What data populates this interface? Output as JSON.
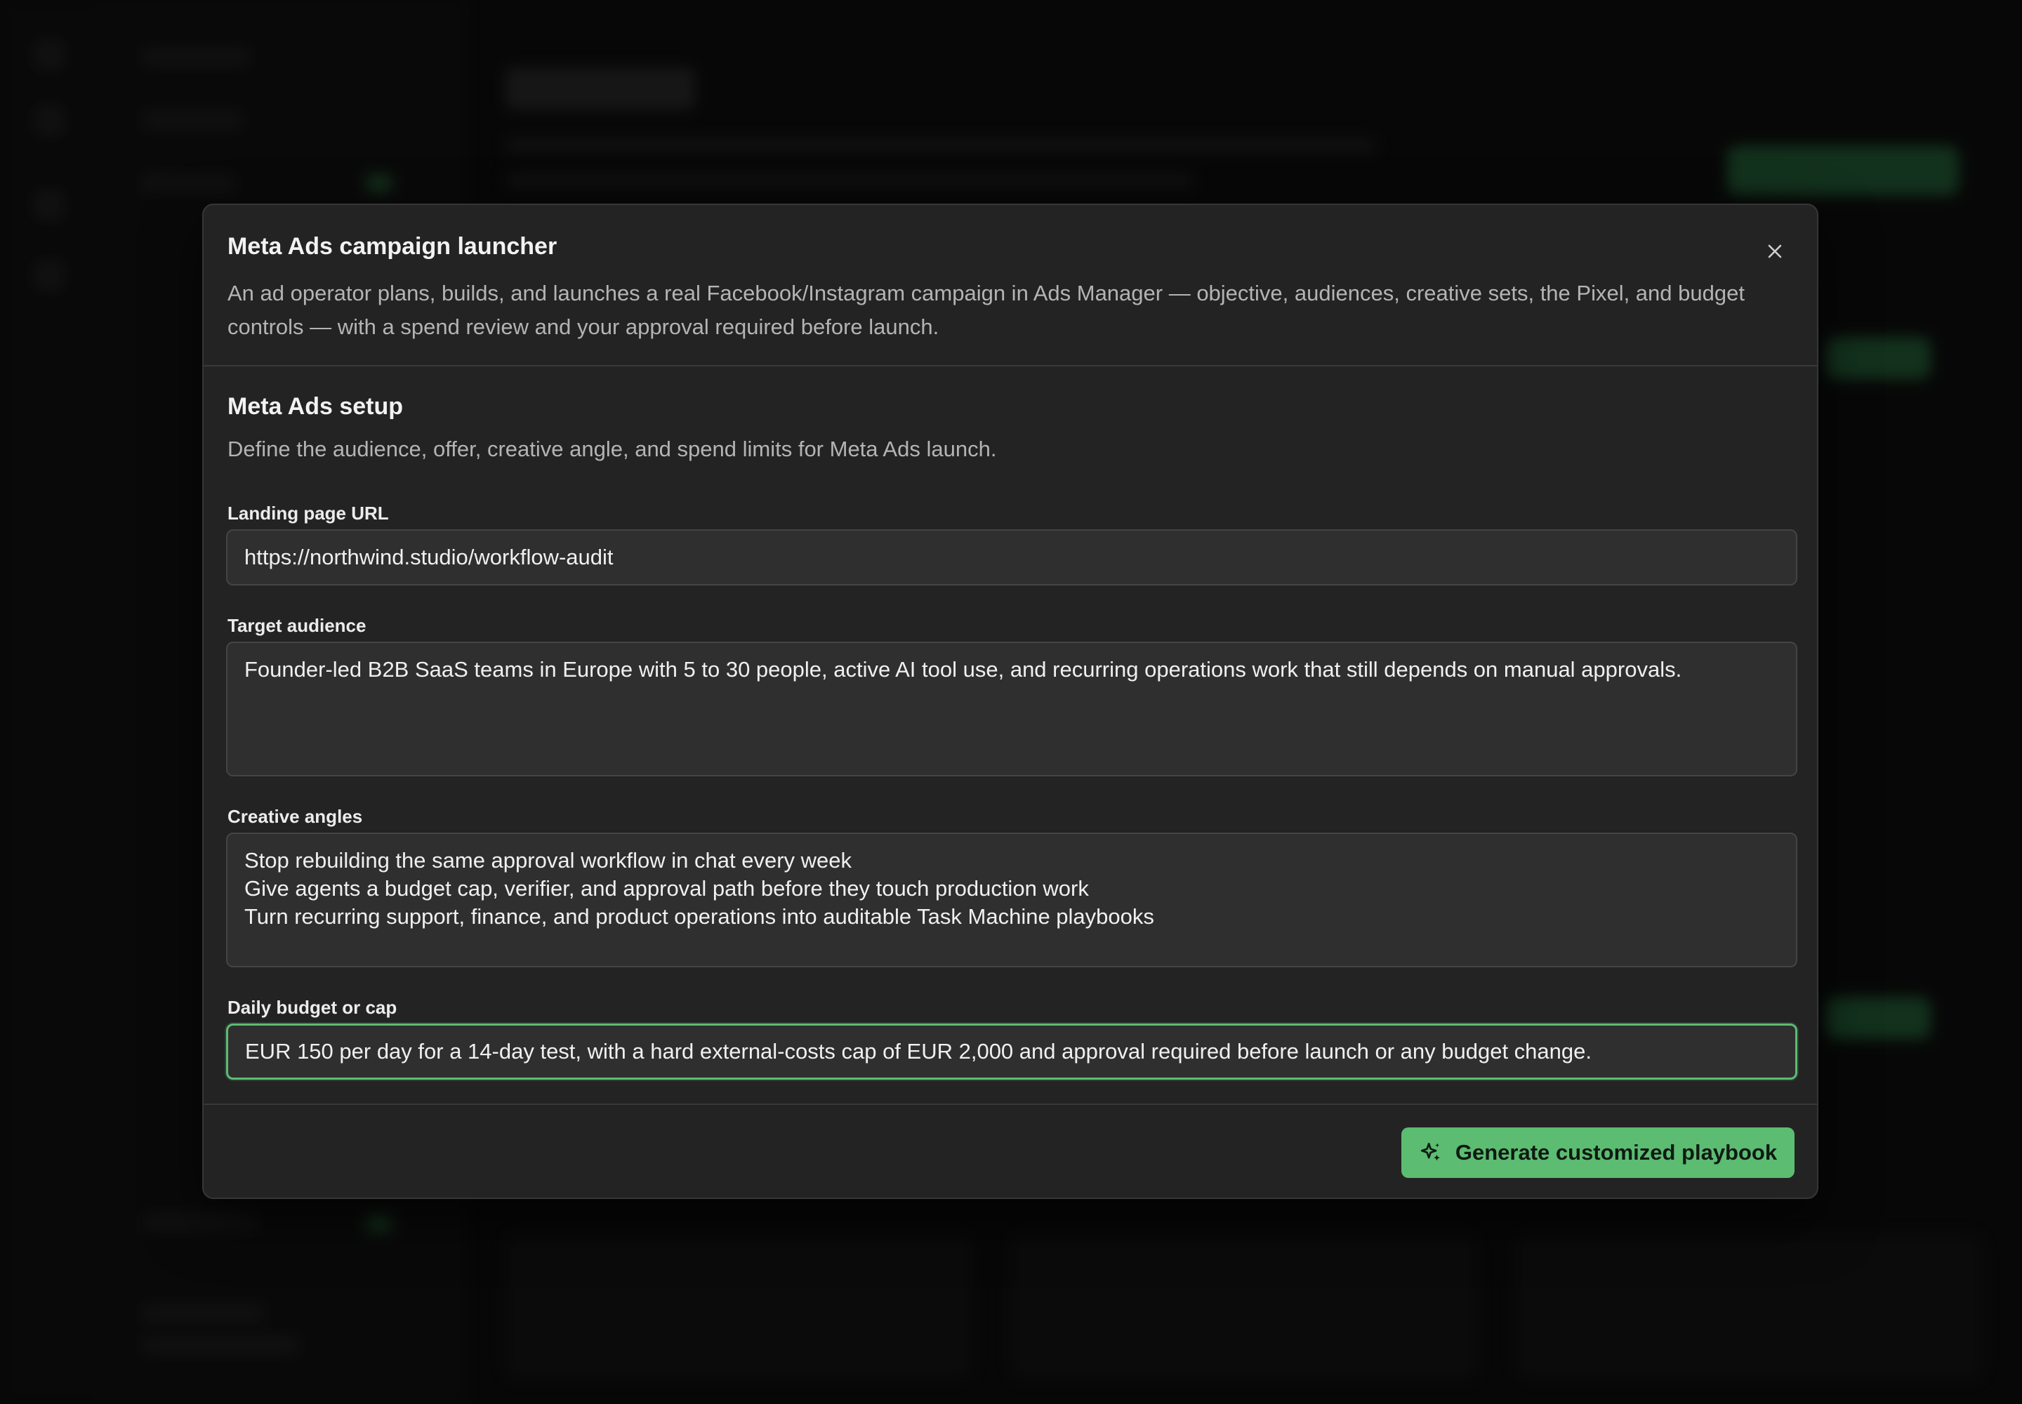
{
  "modal": {
    "title": "Meta Ads campaign launcher",
    "description": "An ad operator plans, builds, and launches a real Facebook/Instagram campaign in Ads Manager — objective, audiences, creative sets, the Pixel, and budget controls — with a spend review and your approval required before launch.",
    "close_icon": "close-icon"
  },
  "setup": {
    "title": "Meta Ads setup",
    "description": "Define the audience, offer, creative angle, and spend limits for Meta Ads launch."
  },
  "fields": {
    "landing_url": {
      "label": "Landing page URL",
      "value": "https://northwind.studio/workflow-audit"
    },
    "target_audience": {
      "label": "Target audience",
      "value": "Founder-led B2B SaaS teams in Europe with 5 to 30 people, active AI tool use, and recurring operations work that still depends on manual approvals."
    },
    "creative_angles": {
      "label": "Creative angles",
      "value": "Stop rebuilding the same approval workflow in chat every week\nGive agents a budget cap, verifier, and approval path before they touch production work\nTurn recurring support, finance, and product operations into auditable Task Machine playbooks"
    },
    "daily_budget": {
      "label": "Daily budget or cap",
      "value": "EUR 150 per day for a 14-day test, with a hard external-costs cap of EUR 2,000 and approval required before launch or any budget change."
    }
  },
  "footer": {
    "generate_label": "Generate customized playbook",
    "generate_icon": "sparkles-icon"
  },
  "colors": {
    "accent": "#5cbc72",
    "modal_bg": "#232323",
    "field_bg": "#2f2f2f",
    "page_bg": "#0c0c0c"
  }
}
